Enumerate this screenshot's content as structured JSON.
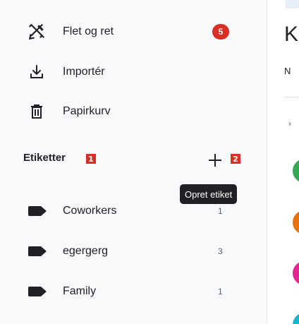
{
  "sidebar": {
    "items": [
      {
        "label": "Flet og ret",
        "icon": "merge-fix-icon",
        "badge": "5"
      },
      {
        "label": "Importér",
        "icon": "import-icon"
      },
      {
        "label": "Papirkurv",
        "icon": "trash-icon"
      }
    ],
    "labels_section": {
      "title": "Etiketter",
      "title_marker": "1",
      "add_marker": "2",
      "add_tooltip": "Opret etiket"
    },
    "labels": [
      {
        "name": "Coworkers",
        "count": "1",
        "icon": "label-icon"
      },
      {
        "name": "egergerg",
        "count": "3",
        "icon": "label-icon"
      },
      {
        "name": "Family",
        "count": "1",
        "icon": "label-icon"
      }
    ]
  },
  "main": {
    "heading_fragment": "K",
    "subtext_fragment": "N",
    "avatar_colors": [
      "#34a853",
      "#e8710a",
      "#e52592",
      "#12b5cb"
    ]
  },
  "colors": {
    "badge": "#d93025",
    "marker": "#d93025",
    "tooltip_bg": "#202124",
    "label_icon": "#202124"
  }
}
